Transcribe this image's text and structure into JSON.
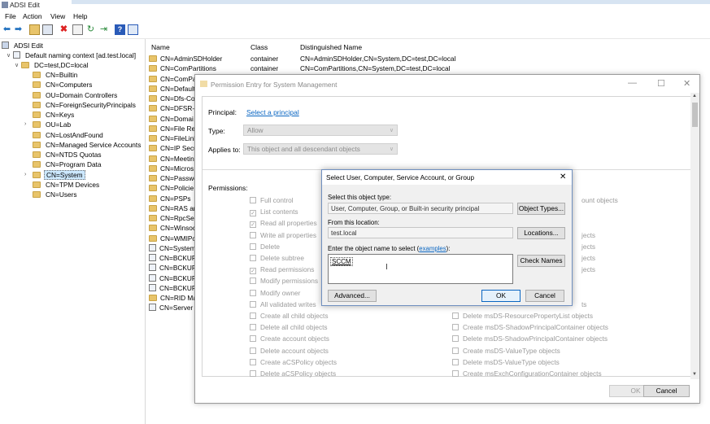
{
  "window": {
    "title": "ADSI Edit"
  },
  "menu": [
    "File",
    "Action",
    "View",
    "Help"
  ],
  "toolbar_icons": [
    "back-arrow-icon",
    "forward-arrow-icon",
    "up-folder-icon",
    "show-hide-tree-icon",
    "delete-icon",
    "properties-icon",
    "refresh-icon",
    "export-icon",
    "help-icon",
    "console-tree-icon"
  ],
  "tree": {
    "root": "ADSI Edit",
    "context": "Default naming context [ad.test.local]",
    "domain": "DC=test,DC=local",
    "items": [
      "CN=Builtin",
      "CN=Computers",
      "OU=Domain Controllers",
      "CN=ForeignSecurityPrincipals",
      "CN=Keys",
      "OU=Lab",
      "CN=LostAndFound",
      "CN=Managed Service Accounts",
      "CN=NTDS Quotas",
      "CN=Program Data",
      "CN=System",
      "CN=TPM Devices",
      "CN=Users"
    ],
    "selected": "CN=System"
  },
  "list": {
    "columns": [
      "Name",
      "Class",
      "Distinguished Name"
    ],
    "rows": [
      {
        "name": "CN=AdminSDHolder",
        "class": "container",
        "dn": "CN=AdminSDHolder,CN=System,DC=test,DC=local"
      },
      {
        "name": "CN=ComPartitions",
        "class": "container",
        "dn": "CN=ComPartitions,CN=System,DC=test,DC=local"
      },
      {
        "name": "CN=ComPa",
        "class": "",
        "dn": ""
      },
      {
        "name": "CN=Default",
        "class": "",
        "dn": ""
      },
      {
        "name": "CN=Dfs-Co",
        "class": "",
        "dn": ""
      },
      {
        "name": "CN=DFSR-G",
        "class": "",
        "dn": ""
      },
      {
        "name": "CN=Domai",
        "class": "",
        "dn": ""
      },
      {
        "name": "CN=File Rep",
        "class": "",
        "dn": ""
      },
      {
        "name": "CN=FileLink",
        "class": "",
        "dn": ""
      },
      {
        "name": "CN=IP Secu",
        "class": "",
        "dn": ""
      },
      {
        "name": "CN=Meetin",
        "class": "",
        "dn": ""
      },
      {
        "name": "CN=Micros",
        "class": "",
        "dn": ""
      },
      {
        "name": "CN=Passwo",
        "class": "",
        "dn": ""
      },
      {
        "name": "CN=Policie",
        "class": "",
        "dn": ""
      },
      {
        "name": "CN=PSPs",
        "class": "",
        "dn": ""
      },
      {
        "name": "CN=RAS an",
        "class": "",
        "dn": ""
      },
      {
        "name": "CN=RpcSer",
        "class": "",
        "dn": ""
      },
      {
        "name": "CN=Winsoc",
        "class": "",
        "dn": ""
      },
      {
        "name": "CN=WMIPo",
        "class": "",
        "dn": ""
      },
      {
        "name": "CN=System",
        "class": "",
        "dn": ""
      },
      {
        "name": "CN=BCKUP",
        "class": "",
        "dn": ""
      },
      {
        "name": "CN=BCKUP",
        "class": "",
        "dn": ""
      },
      {
        "name": "CN=BCKUP",
        "class": "",
        "dn": ""
      },
      {
        "name": "CN=BCKUP",
        "class": "",
        "dn": ""
      },
      {
        "name": "CN=RID Ma",
        "class": "",
        "dn": ""
      },
      {
        "name": "CN=Server",
        "class": "",
        "dn": ""
      }
    ]
  },
  "perm_dialog": {
    "title": "Permission Entry for System Management",
    "principal_label": "Principal:",
    "principal_link": "Select a principal",
    "type_label": "Type:",
    "type_value": "Allow",
    "applies_label": "Applies to:",
    "applies_value": "This object and all descendant objects",
    "permissions_label": "Permissions:",
    "left_perms": [
      {
        "label": "Full control",
        "checked": false
      },
      {
        "label": "List contents",
        "checked": true
      },
      {
        "label": "Read all properties",
        "checked": true
      },
      {
        "label": "Write all properties",
        "checked": false
      },
      {
        "label": "Delete",
        "checked": false
      },
      {
        "label": "Delete subtree",
        "checked": false
      },
      {
        "label": "Read permissions",
        "checked": true
      },
      {
        "label": "Modify permissions",
        "checked": false
      },
      {
        "label": "Modify owner",
        "checked": false
      },
      {
        "label": "All validated writes",
        "checked": false
      },
      {
        "label": "Create all child objects",
        "checked": false
      },
      {
        "label": "Delete all child objects",
        "checked": false
      },
      {
        "label": "Create account objects",
        "checked": false
      },
      {
        "label": "Delete account objects",
        "checked": false
      },
      {
        "label": "Create aCSPolicy objects",
        "checked": false
      },
      {
        "label": "Delete aCSPolicy objects",
        "checked": false
      }
    ],
    "right_partial": [
      "ount objects",
      "jects",
      "jects",
      "jects",
      "jects",
      "ts"
    ],
    "right_perms": [
      "Delete msDS-ResourcePropertyList objects",
      "Create msDS-ShadowPrincipalContainer objects",
      "Delete msDS-ShadowPrincipalContainer objects",
      "Create msDS-ValueType objects",
      "Delete msDS-ValueType objects",
      "Create msExchConfigurationContainer objects"
    ],
    "ok": "OK",
    "cancel": "Cancel"
  },
  "select_dialog": {
    "title": "Select User, Computer, Service Account, or Group",
    "object_type_label": "Select this object type:",
    "object_type_value": "User, Computer, Group, or Built-in security principal",
    "object_types_btn": "Object Types...",
    "location_label": "From this location:",
    "location_value": "test.local",
    "locations_btn": "Locations...",
    "enter_label_pre": "Enter the object name to select (",
    "enter_label_link": "examples",
    "enter_label_post": "):",
    "name_value": "SCCM",
    "check_names_btn": "Check Names",
    "advanced_btn": "Advanced...",
    "ok": "OK",
    "cancel": "Cancel"
  }
}
